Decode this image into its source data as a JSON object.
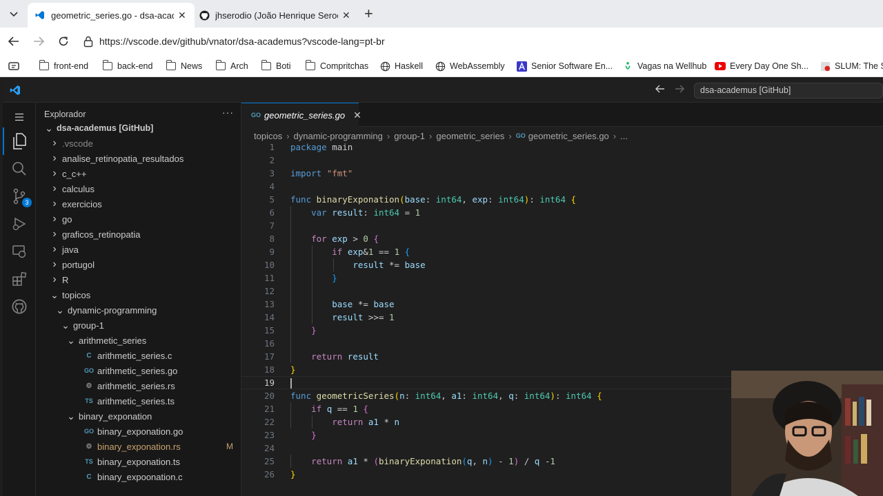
{
  "browser": {
    "tabs": [
      {
        "title": "geometric_series.go - dsa-academ",
        "active": true
      },
      {
        "title": "jhserodio (João Henrique Serodio)",
        "active": false
      }
    ],
    "url": "https://vscode.dev/github/vnator/dsa-academus?vscode-lang=pt-br",
    "bookmarks": [
      "front-end",
      "back-end",
      "News",
      "Arch",
      "Boti",
      "Compritchas",
      "Haskell",
      "WebAssembly",
      "Senior Software En...",
      "Vagas na Wellhub",
      "Every Day One Sh...",
      "SLUM: The Sh"
    ]
  },
  "vscode": {
    "command_center": "dsa-academus [GitHub]",
    "scm_badge": "3",
    "explorer": {
      "title": "Explorador",
      "root": "dsa-academus [GitHub]",
      "items": [
        {
          "label": ".vscode",
          "type": "folder",
          "depth": 1,
          "open": false
        },
        {
          "label": "analise_retinopatia_resultados",
          "type": "folder",
          "depth": 1,
          "open": false
        },
        {
          "label": "c_c++",
          "type": "folder",
          "depth": 1,
          "open": false
        },
        {
          "label": "calculus",
          "type": "folder",
          "depth": 1,
          "open": false
        },
        {
          "label": "exercicios",
          "type": "folder",
          "depth": 1,
          "open": false
        },
        {
          "label": "go",
          "type": "folder",
          "depth": 1,
          "open": false
        },
        {
          "label": "graficos_retinopatia",
          "type": "folder",
          "depth": 1,
          "open": false
        },
        {
          "label": "java",
          "type": "folder",
          "depth": 1,
          "open": false
        },
        {
          "label": "portugol",
          "type": "folder",
          "depth": 1,
          "open": false
        },
        {
          "label": "R",
          "type": "folder",
          "depth": 1,
          "open": false
        },
        {
          "label": "topicos",
          "type": "folder",
          "depth": 1,
          "open": true
        },
        {
          "label": "dynamic-programming",
          "type": "folder",
          "depth": 2,
          "open": true
        },
        {
          "label": "group-1",
          "type": "folder",
          "depth": 3,
          "open": true
        },
        {
          "label": "arithmetic_series",
          "type": "folder",
          "depth": 4,
          "open": true
        },
        {
          "label": "arithmetic_series.c",
          "type": "c",
          "depth": 5
        },
        {
          "label": "arithmetic_series.go",
          "type": "go",
          "depth": 5
        },
        {
          "label": "arithmetic_series.rs",
          "type": "rs",
          "depth": 5
        },
        {
          "label": "arithmetic_series.ts",
          "type": "ts",
          "depth": 5
        },
        {
          "label": "binary_exponation",
          "type": "folder",
          "depth": 4,
          "open": true
        },
        {
          "label": "binary_exponation.go",
          "type": "go",
          "depth": 5
        },
        {
          "label": "binary_exponation.rs",
          "type": "rs",
          "depth": 5,
          "modified": "M"
        },
        {
          "label": "binary_exponation.ts",
          "type": "ts",
          "depth": 5
        },
        {
          "label": "binary_expoonation.c",
          "type": "c",
          "depth": 5
        }
      ]
    },
    "editor": {
      "tab": "geometric_series.go",
      "breadcrumb": [
        "topicos",
        "dynamic-programming",
        "group-1",
        "geometric_series",
        "geometric_series.go",
        "..."
      ],
      "current_line": 19,
      "lines": [
        "package main",
        "",
        "import \"fmt\"",
        "",
        "func binaryExponation(base: int64, exp: int64): int64 {",
        "    var result: int64 = 1",
        "",
        "    for exp > 0 {",
        "        if exp&1 == 1 {",
        "            result *= base",
        "        }",
        "",
        "        base *= base",
        "        result >>= 1",
        "    }",
        "",
        "    return result",
        "}",
        "",
        "func geometricSeries(n: int64, a1: int64, q: int64): int64 {",
        "    if q == 1 {",
        "        return a1 * n",
        "    }",
        "",
        "    return a1 * (binaryExponation(q, n) - 1) / q -1",
        "}"
      ]
    }
  }
}
